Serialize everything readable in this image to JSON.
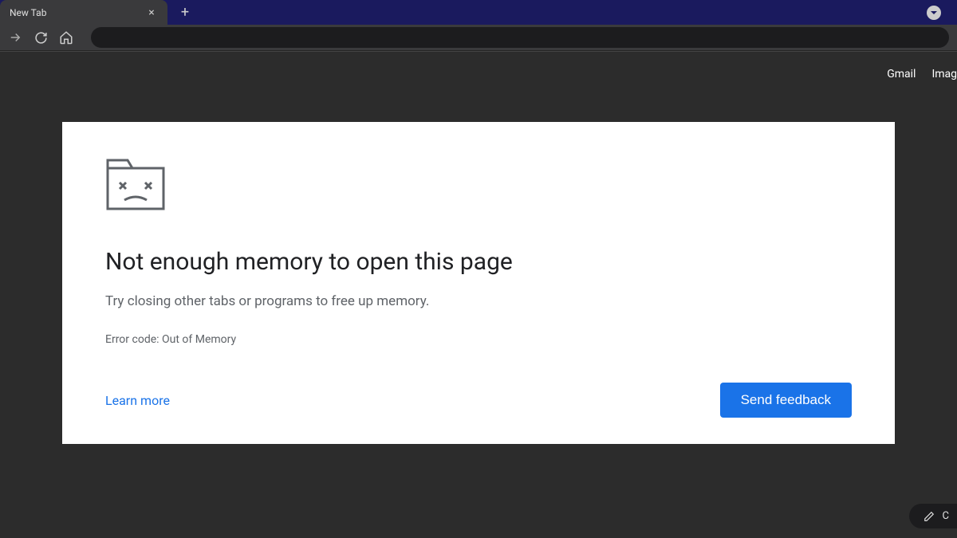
{
  "tab": {
    "title": "New Tab"
  },
  "top_links": {
    "gmail": "Gmail",
    "images": "Imag"
  },
  "error": {
    "title": "Not enough memory to open this page",
    "description": "Try closing other tabs or programs to free up memory.",
    "code": "Error code: Out of Memory",
    "learn_more": "Learn more",
    "send_feedback": "Send feedback"
  },
  "customize": {
    "label": "C"
  }
}
